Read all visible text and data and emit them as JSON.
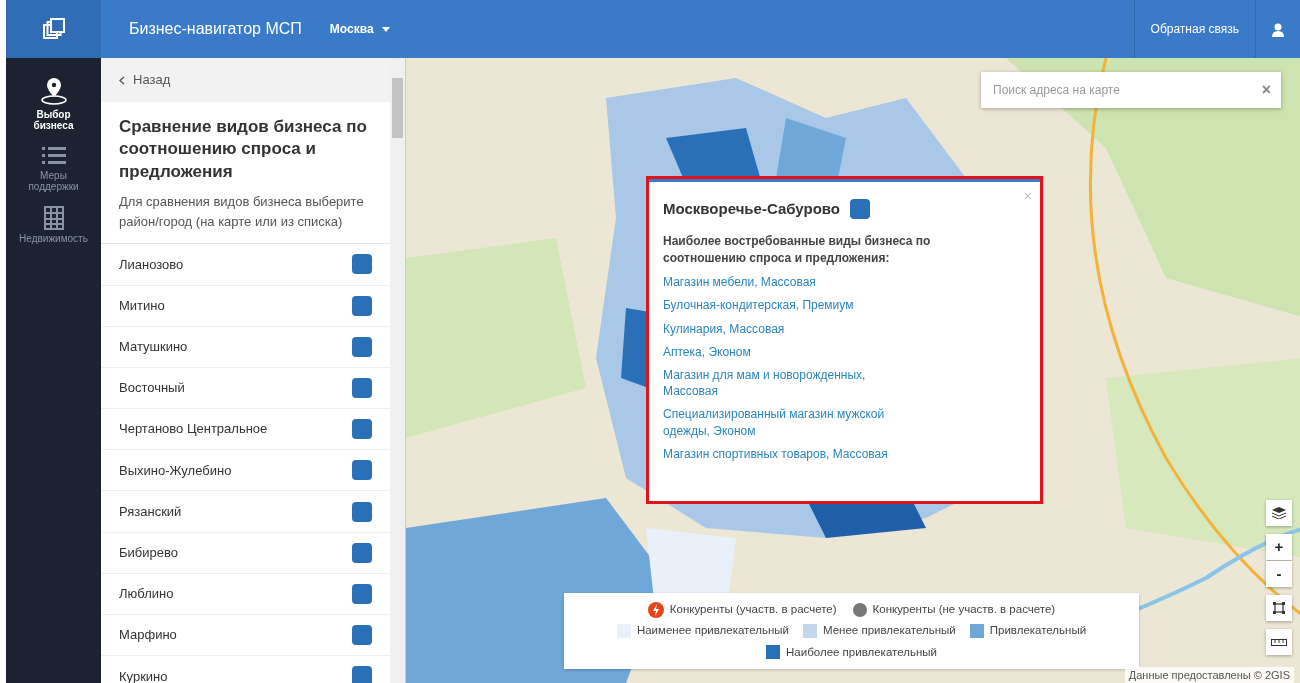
{
  "app": {
    "title": "Бизнес-навигатор МСП",
    "city": "Москва",
    "feedback": "Обратная связь"
  },
  "rail": [
    {
      "label": "Выбор бизнеса",
      "selected": true
    },
    {
      "label": "Меры поддержки",
      "selected": false
    },
    {
      "label": "Недвижимость",
      "selected": false
    }
  ],
  "panel": {
    "back": "Назад",
    "title": "Сравнение видов бизнеса по соотношению спроса и предложения",
    "hint": "Для сравнения видов бизнеса выберите район/город (на карте или из списка)",
    "districts": [
      {
        "name": "Лианозово",
        "color": "#2a70b9"
      },
      {
        "name": "Митино",
        "color": "#2a70b9"
      },
      {
        "name": "Матушкино",
        "color": "#2a70b9"
      },
      {
        "name": "Восточный",
        "color": "#2a70b9"
      },
      {
        "name": "Чертаново Центральное",
        "color": "#2a70b9"
      },
      {
        "name": "Выхино-Жулебино",
        "color": "#2a70b9"
      },
      {
        "name": "Рязанский",
        "color": "#2a70b9"
      },
      {
        "name": "Бибирево",
        "color": "#2a70b9"
      },
      {
        "name": "Люблино",
        "color": "#2a70b9"
      },
      {
        "name": "Марфино",
        "color": "#2a70b9"
      },
      {
        "name": "Куркино",
        "color": "#2a70b9"
      }
    ]
  },
  "map": {
    "search": {
      "placeholder": "Поиск адреса на карте",
      "clear": "×"
    },
    "popup": {
      "title": "Москворечье-Сабурово",
      "color": "#2a70b9",
      "close": "×",
      "subtitle": "Наиболее востребованные виды бизнеса по соотношению спроса и предложения:",
      "links": [
        "Магазин мебели, Массовая",
        "Булочная-кондитерская, Премиум",
        "Кулинария, Массовая",
        "Аптека, Эконом",
        "Магазин для мам и новорожденных, Массовая",
        "Специализированный магазин мужской одежды, Эконом",
        "Магазин спортивных товаров, Массовая"
      ]
    },
    "controls": [
      "+",
      "-"
    ],
    "legend": {
      "markers": [
        {
          "label": "Конкуренты (участв. в расчете)",
          "kind": "active"
        },
        {
          "label": "Конкуренты (не участв. в расчете)",
          "kind": "inactive"
        }
      ],
      "scale": [
        {
          "label": "Наименее привлекательный",
          "color": "#eaf0fa"
        },
        {
          "label": "Менее привлекательный",
          "color": "#c3d7ec"
        },
        {
          "label": "Привлекательный",
          "color": "#6fa7d8"
        },
        {
          "label": "Наиболее привлекательный",
          "color": "#2a70b9"
        }
      ]
    },
    "attribution": "Данные предоставлены © 2GIS"
  }
}
